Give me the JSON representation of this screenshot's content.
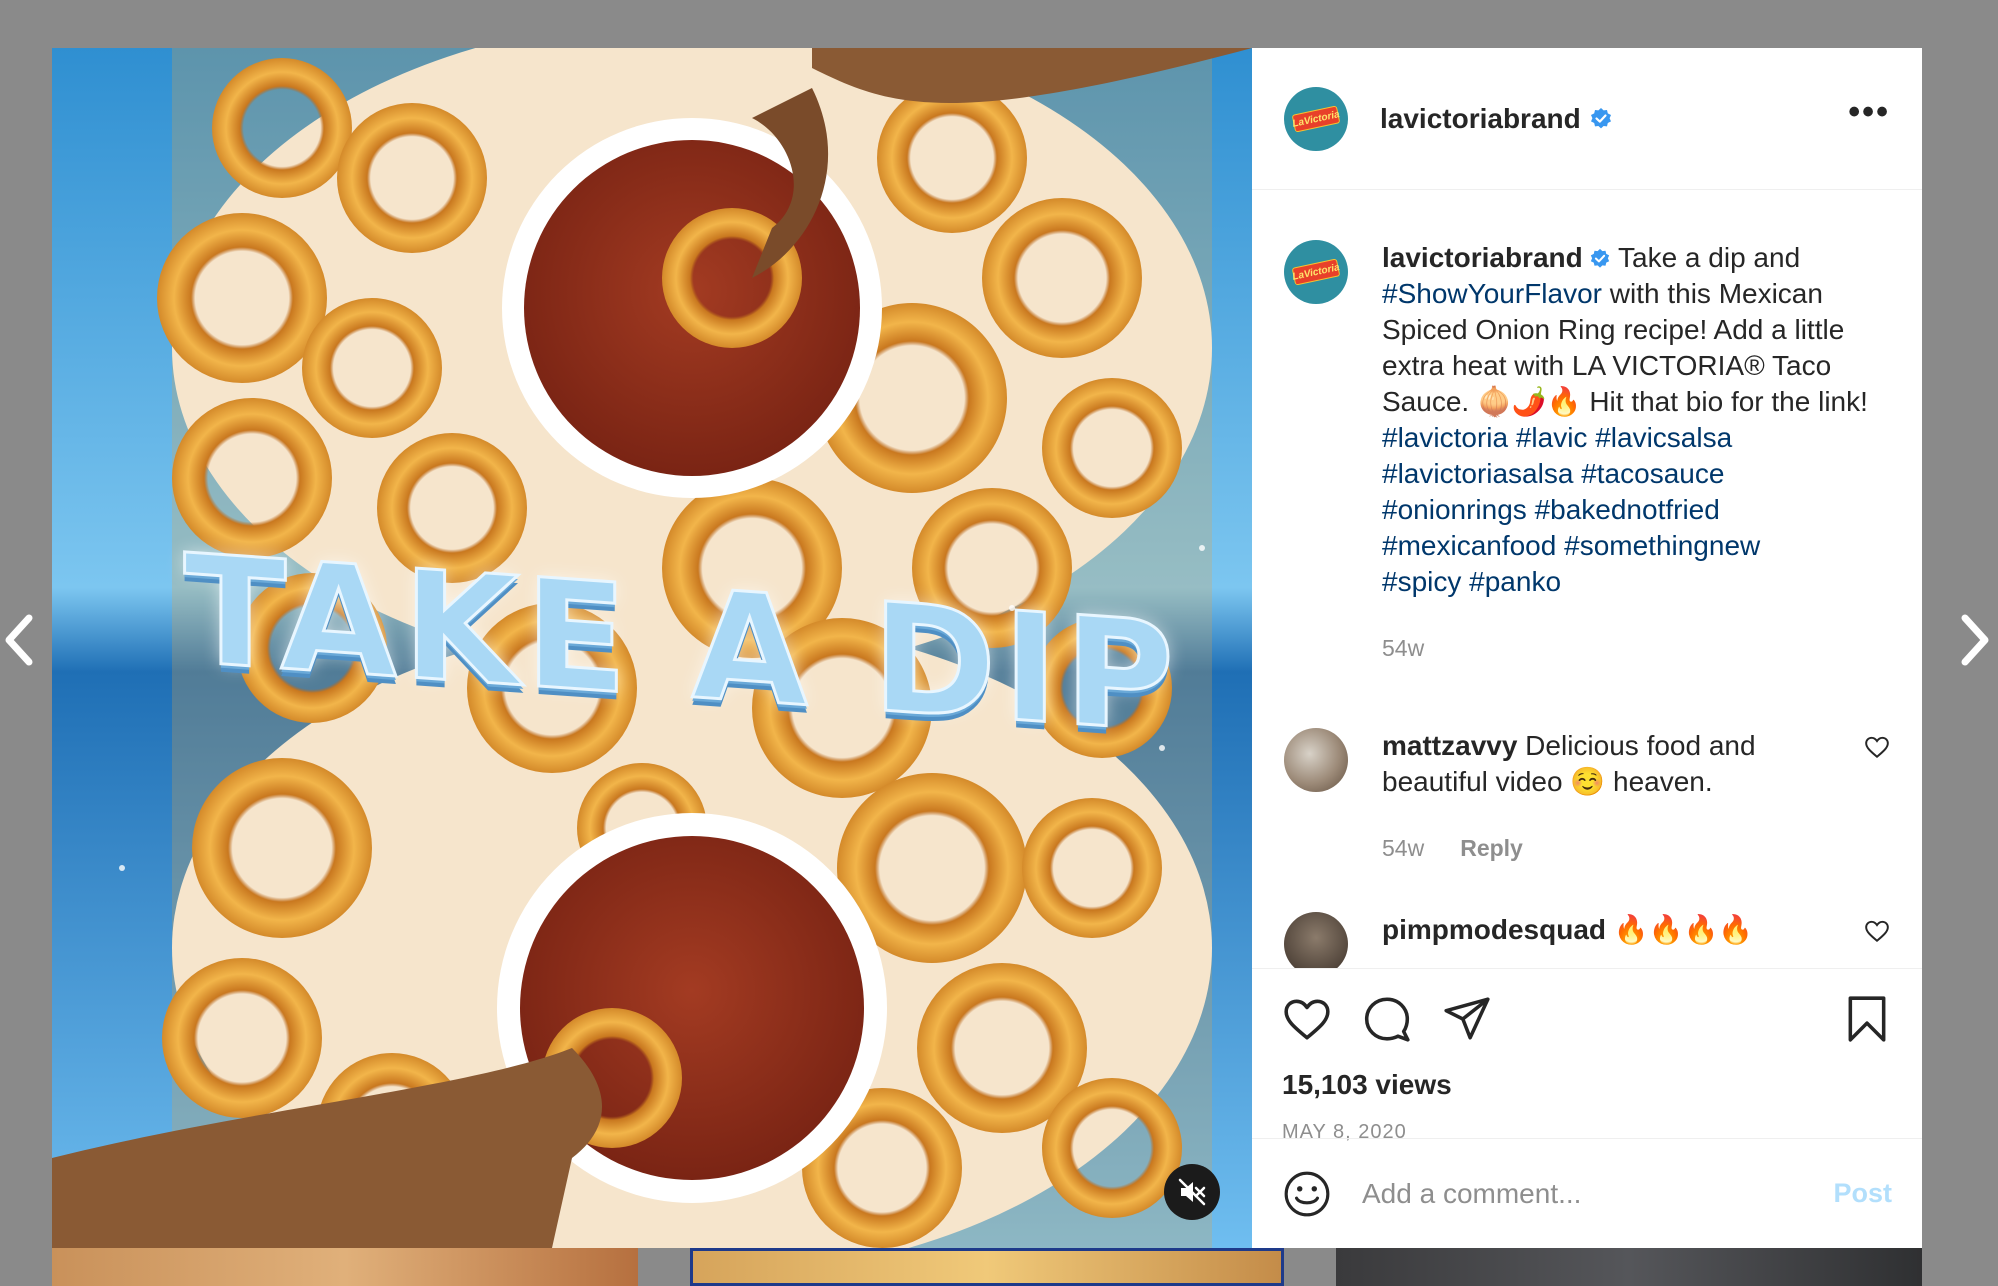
{
  "post": {
    "username": "lavictoriabrand",
    "avatar_logo": "LaVictoria",
    "more_label": "•••",
    "overlay_text": "TAKE A DIP",
    "caption": {
      "username": "lavictoriabrand",
      "text_1": " Take a dip and ",
      "hashtag_main": "#ShowYourFlavor",
      "text_2": " with this Mexican Spiced Onion Ring recipe! Add a little extra heat with LA VICTORIA® Taco Sauce. 🧅🌶️🔥 Hit that bio for the link!",
      "hashtags": [
        "#lavictoria",
        "#lavic",
        "#lavicsalsa",
        "#lavictoriasalsa",
        "#tacosauce",
        "#onionrings",
        "#bakednotfried",
        "#mexicanfood",
        "#somethingnew",
        "#spicy",
        "#panko"
      ],
      "age": "54w"
    },
    "comments": [
      {
        "username": "mattzavvy",
        "text": " Delicious food and beautiful video ☺️ heaven.",
        "age": "54w",
        "reply": "Reply"
      },
      {
        "username": "pimpmodesquad",
        "text": " 🔥🔥🔥🔥"
      }
    ],
    "views": "15,103 views",
    "date": "MAY 8, 2020",
    "comment_placeholder": "Add a comment...",
    "post_label": "Post"
  },
  "colors": {
    "hashtag": "#00376b",
    "verified": "#3897f0",
    "post_disabled": "#b2dffc"
  }
}
